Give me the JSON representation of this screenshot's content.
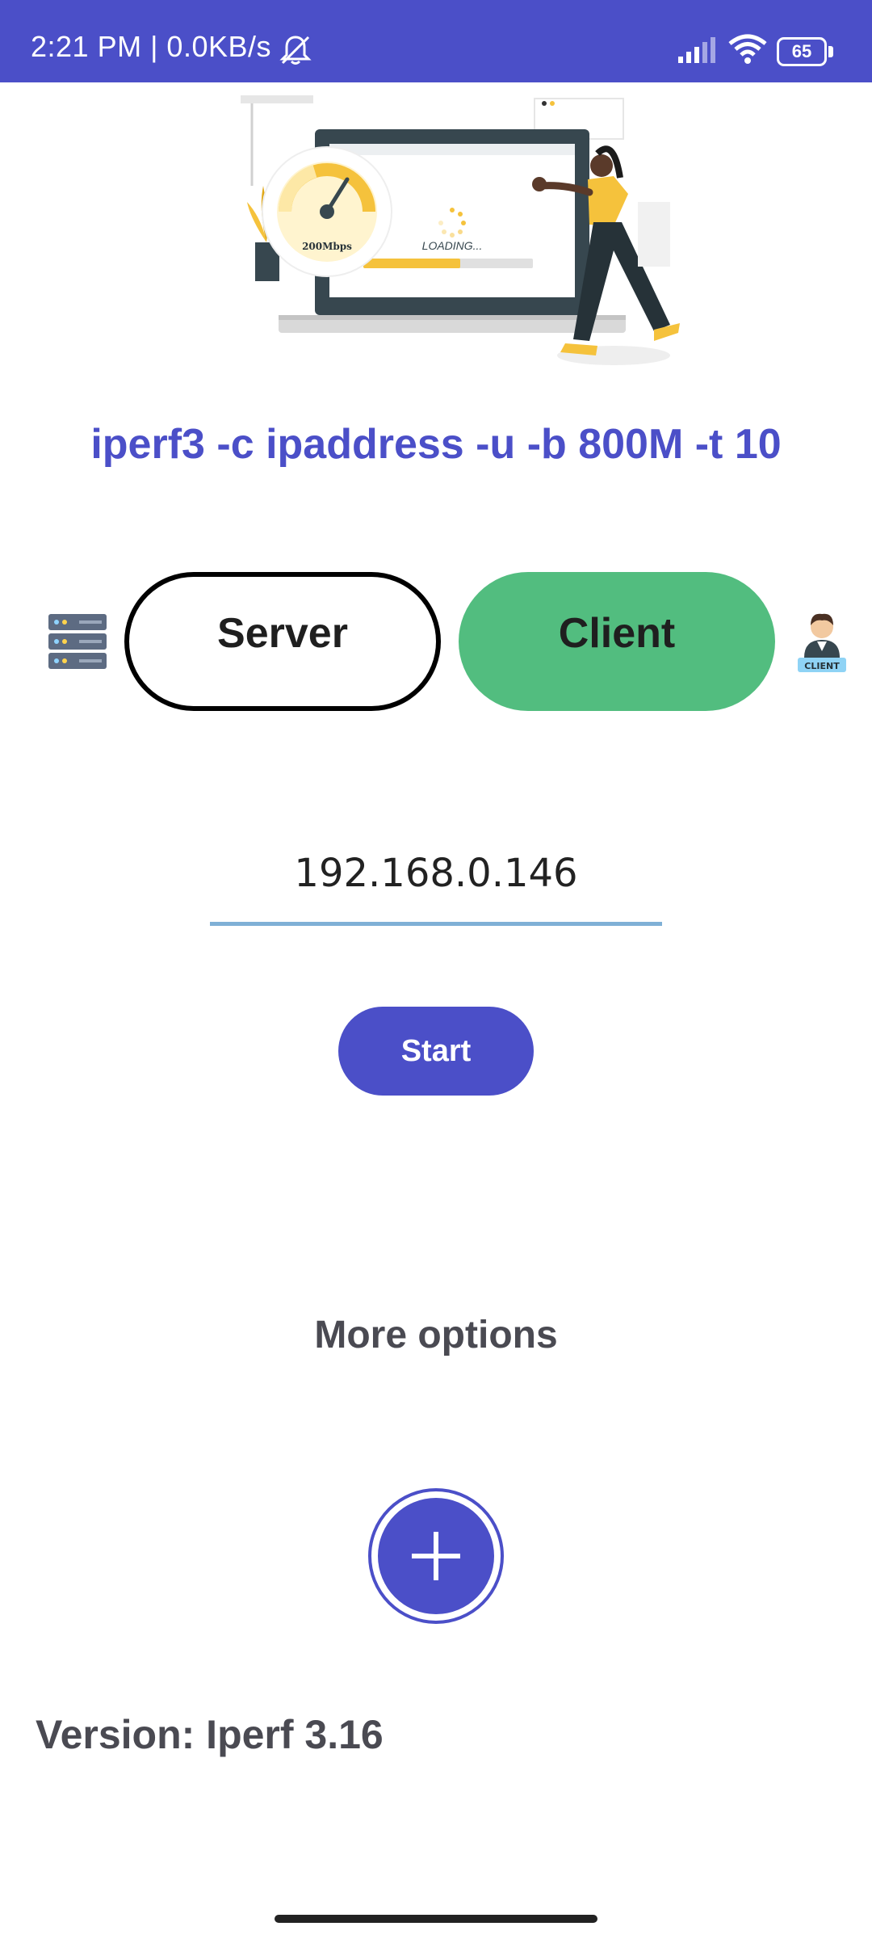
{
  "status_bar": {
    "text": "2:21 PM | 0.0KB/s",
    "battery_level": "65",
    "icons": [
      "bell-off-icon",
      "signal-icon",
      "wifi-icon",
      "battery-icon"
    ]
  },
  "hero": {
    "speed_label": "200Mbps",
    "loading_label": "LOADING..."
  },
  "command": "iperf3 -c ipaddress -u -b 800M -t 10",
  "mode": {
    "server_label": "Server",
    "client_label": "Client",
    "selected": "Client",
    "client_badge": "CLIENT"
  },
  "ip_input": {
    "value": "192.168.0.146"
  },
  "start_button_label": "Start",
  "more_options_label": "More options",
  "version_text": "Version: Iperf 3.16",
  "colors": {
    "primary": "#4b4fc8",
    "client_active": "#52bd7f",
    "input_underline": "#7fb0d6"
  }
}
